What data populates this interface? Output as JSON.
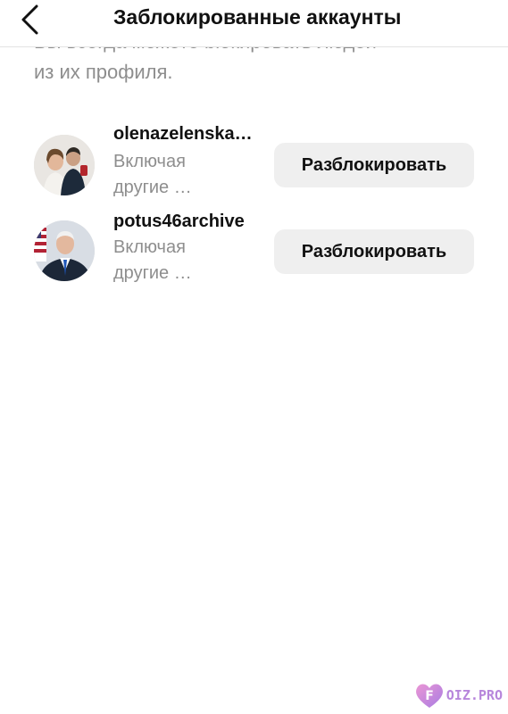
{
  "header": {
    "title": "Заблокированные аккаунты",
    "back_icon": "chevron-left-icon"
  },
  "intro": {
    "line1": "Вы всегда можете blокировать людей",
    "line2": "из их профиля."
  },
  "accounts": [
    {
      "username": "olenazelenska…",
      "subtitle_line1": "Включая",
      "subtitle_line2": "другие …",
      "button_label": "Разблокировать"
    },
    {
      "username": "potus46archive",
      "subtitle_line1": "Включая",
      "subtitle_line2": "другие …",
      "button_label": "Разблокировать"
    }
  ],
  "watermark": {
    "text": "OIZ.PRO",
    "logo": "heart-logo",
    "color": "#b07ad8"
  }
}
